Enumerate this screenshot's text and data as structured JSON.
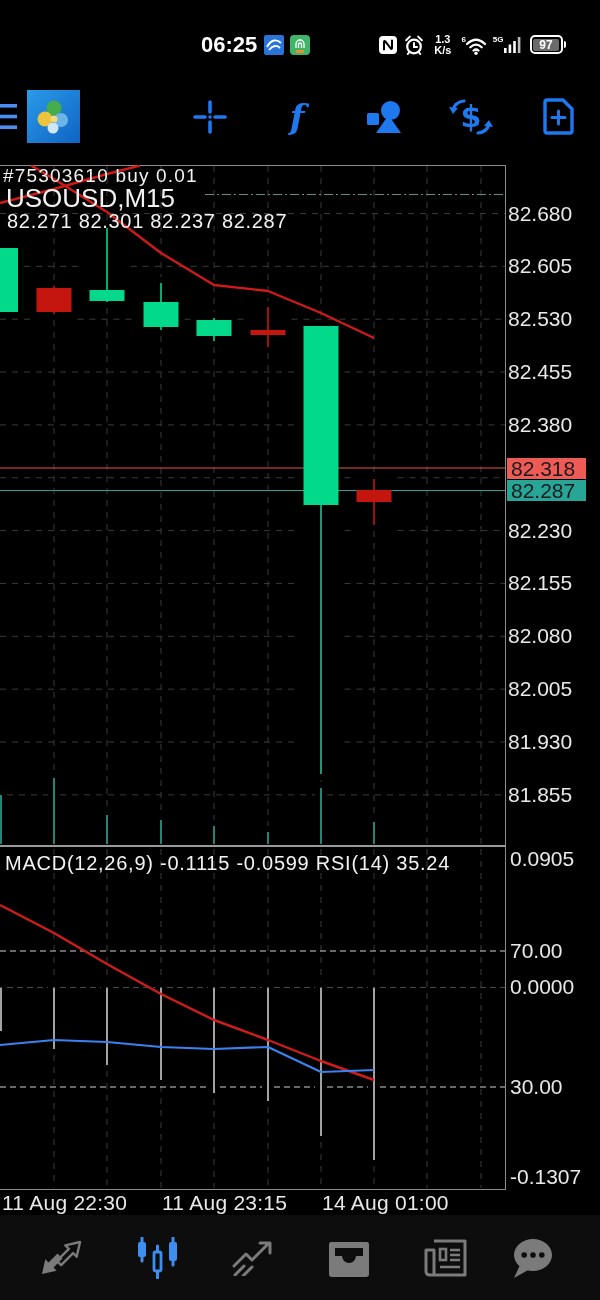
{
  "status_bar": {
    "time": "06:25",
    "net_speed": "1.3",
    "net_speed_unit": "K/s",
    "wifi_label": "6",
    "network_type": "5G",
    "battery": "97"
  },
  "toolbar": {
    "indicators_glyph": "f",
    "trade_glyph": "$"
  },
  "chart": {
    "order_label": "#75303610 buy 0.01",
    "symbol": "USOUSD,M15",
    "ohlc": "82.271 82.301 82.237 82.287",
    "price_ticks": [
      "82.680",
      "82.605",
      "82.530",
      "82.455",
      "82.380",
      "82.230",
      "82.155",
      "82.080",
      "82.005",
      "81.930",
      "81.855"
    ],
    "ask_price": "82.318",
    "bid_price": "82.287"
  },
  "indicator_window": {
    "legend": "MACD(12,26,9) -0.1115 -0.0599 RSI(14) 35.24",
    "scale_labels": [
      "0.0905",
      "70.00",
      "0.0000",
      "30.00",
      "-0.1307"
    ]
  },
  "time_axis": [
    "11 Aug 22:30",
    "11 Aug 23:15",
    "14 Aug 01:00"
  ],
  "bottom_nav": [
    {
      "kind": "quotes",
      "selected": false
    },
    {
      "kind": "chart",
      "selected": true
    },
    {
      "kind": "trade",
      "selected": false
    },
    {
      "kind": "history",
      "selected": false
    },
    {
      "kind": "news",
      "selected": false
    },
    {
      "kind": "messages",
      "selected": false
    }
  ]
}
